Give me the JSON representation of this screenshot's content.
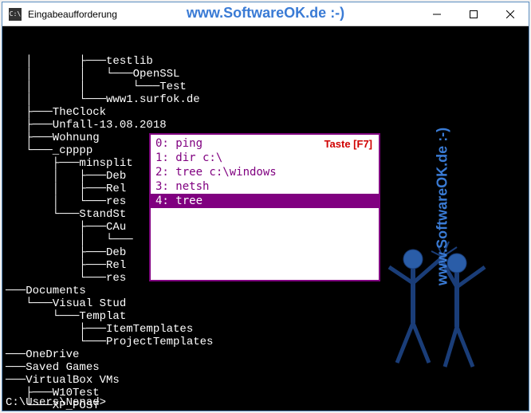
{
  "window": {
    "title": "Eingabeaufforderung"
  },
  "watermark": {
    "top": "www.SoftwareOK.de :-)",
    "side": "www.SoftwareOK.de :-)"
  },
  "tree": {
    "lines": [
      "   │       ├───testlib",
      "   │       │   └───OpenSSL",
      "   │       │       └───Test",
      "   │       └───www1.surfok.de",
      "   ├───TheClock",
      "   ├───Unfall-13.08.2018",
      "   ├───Wohnung",
      "   └───_cpppp",
      "       ├───minsplit",
      "       │   ├───Deb",
      "       │   ├───Rel",
      "       │   └───res",
      "       └───StandSt",
      "           ├───CAu",
      "           │   └───",
      "           ├───Deb",
      "           ├───Rel",
      "           └───res",
      "───Documents",
      "   └───Visual Stud",
      "       └───Templat",
      "           ├───ItemTemplates",
      "           └───ProjectTemplates",
      "───OneDrive",
      "───Saved Games",
      "───VirtualBox VMs",
      "   ├───W10Test",
      "   └───XP_POST"
    ]
  },
  "prompt": "C:\\Users\\Nenad>",
  "history": {
    "hint": "Taste [F7]",
    "items": [
      {
        "index": 0,
        "cmd": "ping",
        "selected": false
      },
      {
        "index": 1,
        "cmd": "dir c:\\",
        "selected": false
      },
      {
        "index": 2,
        "cmd": "tree c:\\windows",
        "selected": false
      },
      {
        "index": 3,
        "cmd": "netsh",
        "selected": false
      },
      {
        "index": 4,
        "cmd": "tree",
        "selected": true
      }
    ]
  }
}
